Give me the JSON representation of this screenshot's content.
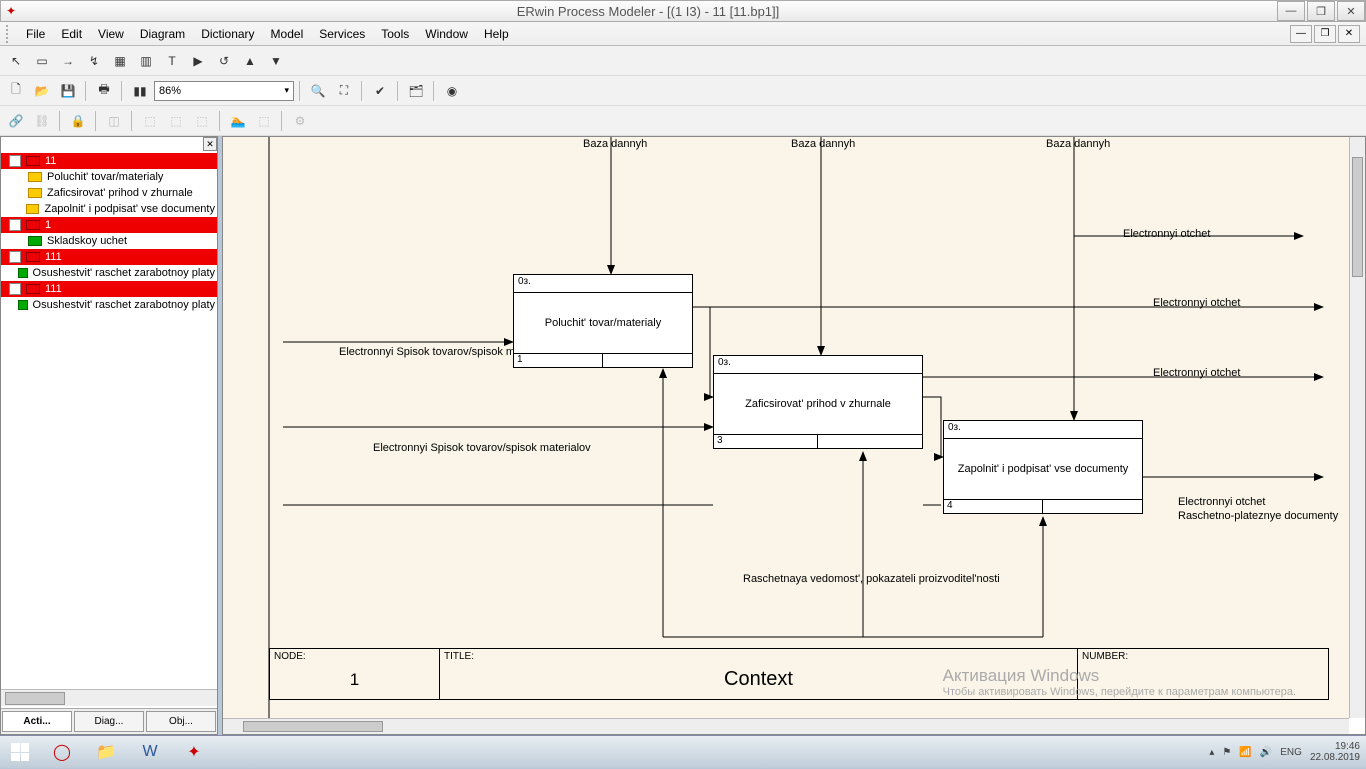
{
  "app": {
    "title": "ERwin Process Modeler - [(1 I3)  - 11  [11.bp1]]"
  },
  "menu": [
    "File",
    "Edit",
    "View",
    "Diagram",
    "Dictionary",
    "Model",
    "Services",
    "Tools",
    "Window",
    "Help"
  ],
  "zoom": "86%",
  "tree": [
    {
      "type": "branch",
      "sel": true,
      "exp": "-",
      "label": "11"
    },
    {
      "type": "leaf",
      "indent": 24,
      "ico": "yel",
      "label": "Poluchit' tovar/materialy"
    },
    {
      "type": "leaf",
      "indent": 24,
      "ico": "yel",
      "label": "Zaficsirovat' prihod v zhurnale"
    },
    {
      "type": "leaf",
      "indent": 24,
      "ico": "yel",
      "label": "Zapolnit' i podpisat' vse documenty"
    },
    {
      "type": "branch",
      "sel": true,
      "exp": "+",
      "label": "1"
    },
    {
      "type": "leaf",
      "indent": 24,
      "ico": "grn",
      "label": "Skladskoy uchet"
    },
    {
      "type": "branch",
      "sel": true,
      "exp": "+",
      "label": "111"
    },
    {
      "type": "leaf",
      "indent": 24,
      "ico": "grn",
      "label": "Osushestvit' raschet  zarabotnoy platy"
    },
    {
      "type": "branch",
      "sel": true,
      "exp": "+",
      "label": "111"
    },
    {
      "type": "leaf",
      "indent": 24,
      "ico": "grn",
      "label": "Osushestvit' raschet  zarabotnoy platy"
    }
  ],
  "lp_tabs": [
    "Acti...",
    "Diag...",
    "Obj..."
  ],
  "diagram": {
    "top_labels": {
      "a": "Baza dannyh",
      "b": "Baza dannyh",
      "c": "Baza dannyh"
    },
    "boxes": {
      "b1": {
        "code": "0з.",
        "title": "Poluchit' tovar/materialy",
        "num": "1"
      },
      "b2": {
        "code": "0з.",
        "title": "Zaficsirovat' prihod v zhurnale",
        "num": "3"
      },
      "b3": {
        "code": "0з.",
        "title": "Zapolnit' i podpisat' vse documenty",
        "num": "4"
      }
    },
    "edge_labels": {
      "in1": "Electronnyi Spisok tovarov/spisok materialov",
      "in2": "Electronnyi Spisok tovarov/spisok materialov",
      "out_top": "Electronnyi otchet",
      "out1": "Electronnyi otchet",
      "out2": "Electronnyi otchet",
      "out3a": "Electronnyi otchet",
      "out3b": "Raschetno-plateznye documenty",
      "bottom": "Raschetnaya vedomost', pokazateli proizvoditel'nosti"
    },
    "footer": {
      "node_h": "NODE:",
      "node_v": "1",
      "title_h": "TITLE:",
      "title_v": "Context",
      "num_h": "NUMBER:"
    }
  },
  "watermark": {
    "h": "Активация Windows",
    "s": "Чтобы активировать Windows, перейдите к параметрам компьютера."
  },
  "tray": {
    "lang": "ENG",
    "time": "19:46",
    "date": "22.08.2019"
  }
}
